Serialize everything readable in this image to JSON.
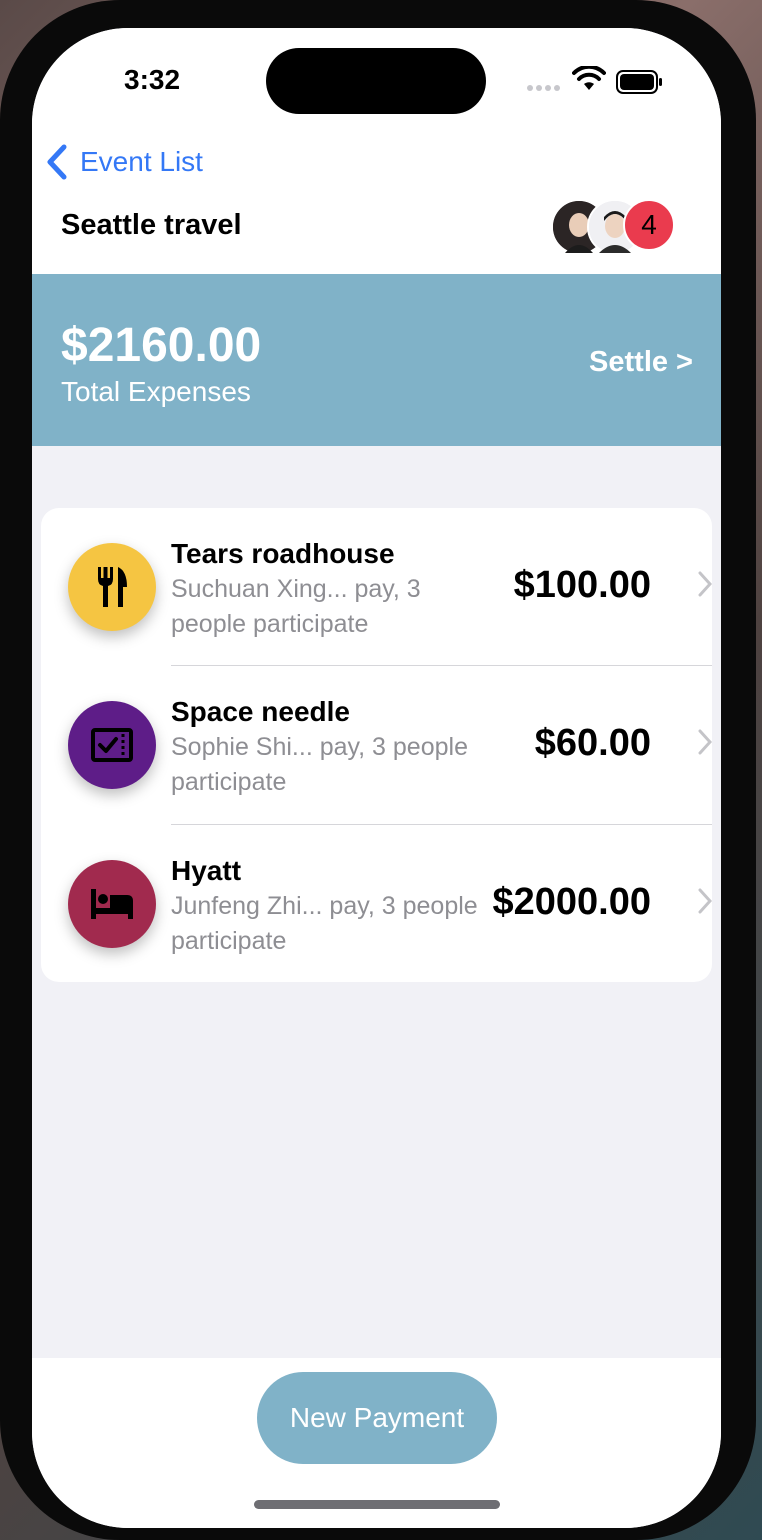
{
  "status_bar": {
    "time": "3:32"
  },
  "nav": {
    "back_label": "Event List"
  },
  "header": {
    "title": "Seattle travel",
    "member_count": "4"
  },
  "summary": {
    "total_amount": "$2160.00",
    "total_label": "Total Expenses",
    "settle_label": "Settle >"
  },
  "expenses": [
    {
      "name": "Tears roadhouse",
      "desc": "Suchuan Xing... pay, 3 people participate",
      "amount": "$100.00",
      "icon": "fork-knife-icon",
      "color": "#f5c542"
    },
    {
      "name": "Space needle",
      "desc": "Sophie Shi... pay, 3 people participate",
      "amount": "$60.00",
      "icon": "ticket-icon",
      "color": "#5e1d88"
    },
    {
      "name": "Hyatt",
      "desc": "Junfeng Zhi... pay, 3 people participate",
      "amount": "$2000.00",
      "icon": "bed-icon",
      "color": "#a12a4e"
    }
  ],
  "actions": {
    "new_payment_label": "New Payment"
  }
}
